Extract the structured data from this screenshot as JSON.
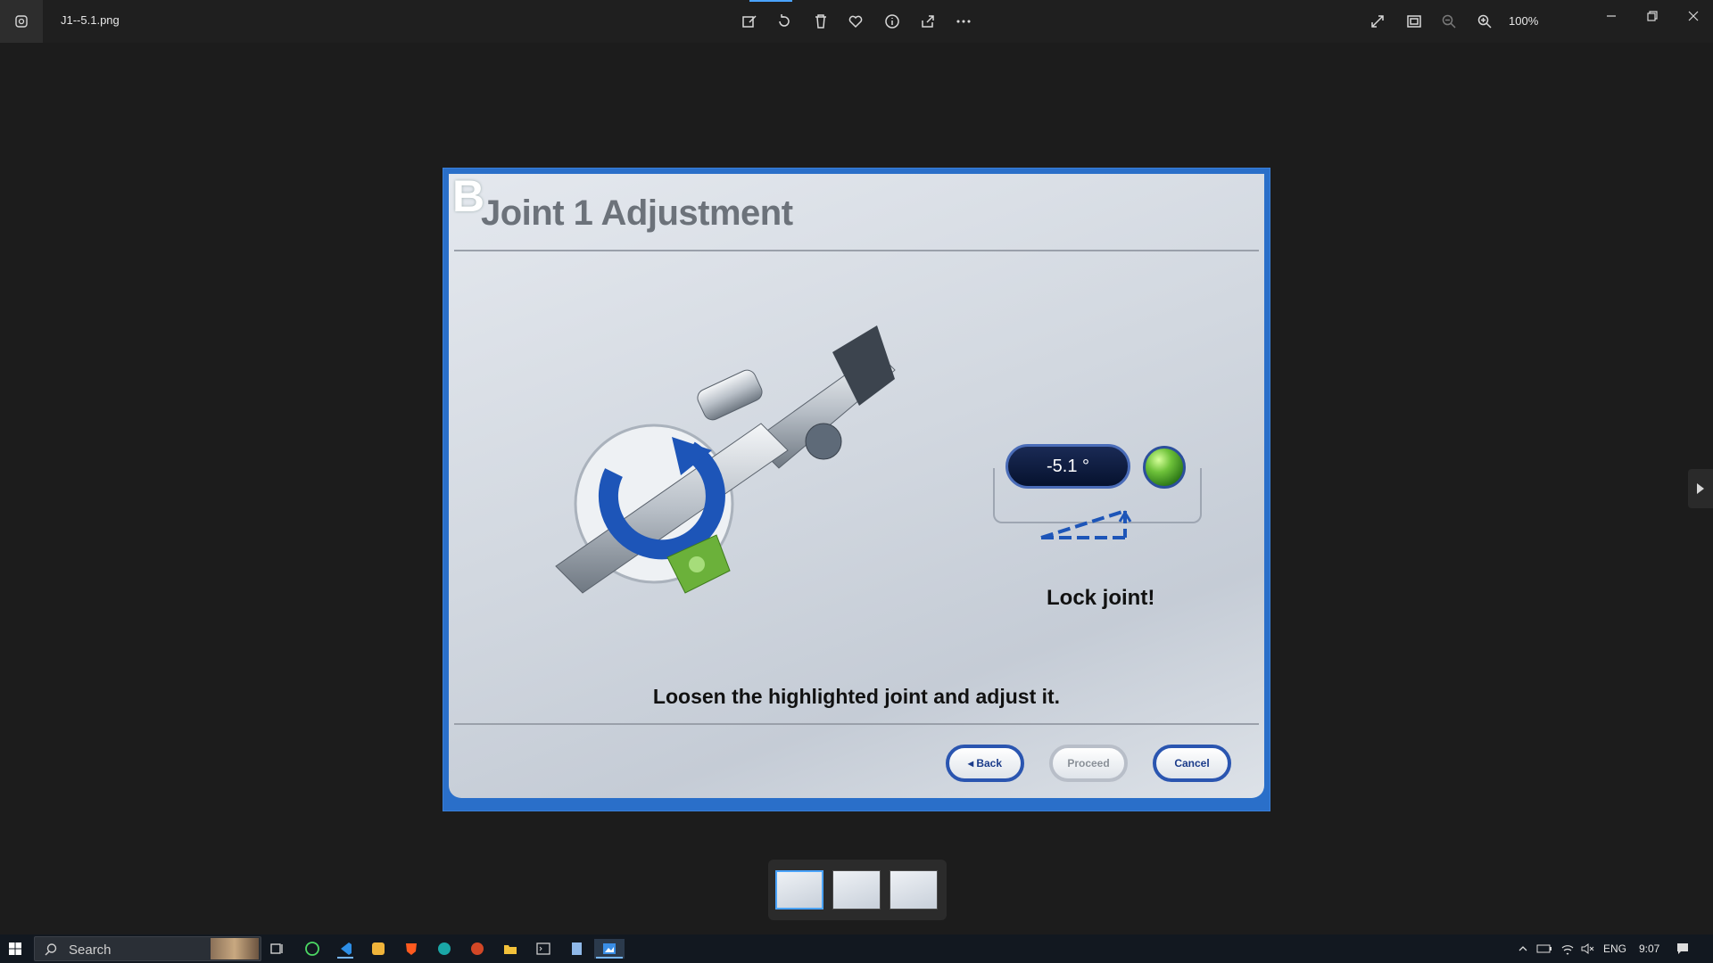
{
  "window": {
    "filename": "J1--5.1.png",
    "zoom": "100%"
  },
  "dialog": {
    "corner_letter": "B",
    "title": "Joint 1 Adjustment",
    "angle_value": "-5.1 °",
    "status": "Lock joint!",
    "instruction": "Loosen the highlighted joint and adjust it.",
    "buttons": {
      "back": "◂ Back",
      "proceed": "Proceed",
      "cancel": "Cancel"
    }
  },
  "filmstrip": {
    "count": 3,
    "selected_index": 0
  },
  "taskbar": {
    "search_placeholder": "Search",
    "language": "ENG",
    "time": "9:07"
  },
  "colors": {
    "accent": "#4aa3ff",
    "dialog_blue": "#2a55b0",
    "status_green": "#6ec23a"
  }
}
